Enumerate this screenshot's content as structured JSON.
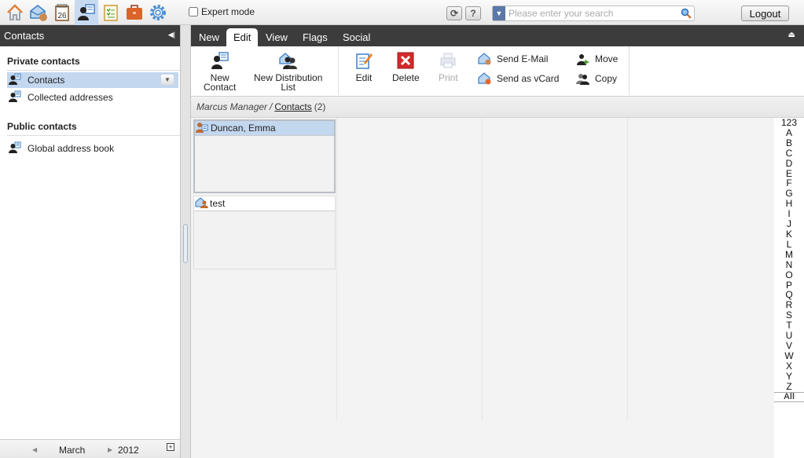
{
  "topbar": {
    "apps": [
      {
        "name": "portal",
        "icon": "home-icon"
      },
      {
        "name": "mail",
        "icon": "mail-icon"
      },
      {
        "name": "calendar",
        "icon": "calendar-icon",
        "label": "26"
      },
      {
        "name": "contacts",
        "icon": "contacts-icon",
        "active": true
      },
      {
        "name": "tasks",
        "icon": "tasks-icon"
      },
      {
        "name": "infostore",
        "icon": "briefcase-icon"
      },
      {
        "name": "settings",
        "icon": "gear-icon"
      }
    ],
    "expert_mode_label": "Expert mode",
    "expert_mode_checked": false,
    "refresh_label": "⟳",
    "help_label": "?",
    "search_placeholder": "Please enter your search",
    "search_value": "",
    "logout_label": "Logout"
  },
  "sidebar": {
    "title": "Contacts",
    "private_title": "Private contacts",
    "private_items": [
      {
        "label": "Contacts",
        "selected": true
      },
      {
        "label": "Collected addresses",
        "selected": false
      }
    ],
    "public_title": "Public contacts",
    "public_items": [
      {
        "label": "Global address book"
      }
    ],
    "footer": {
      "month": "March",
      "year": "2012"
    }
  },
  "tabs": [
    {
      "label": "New",
      "active": false
    },
    {
      "label": "Edit",
      "active": true
    },
    {
      "label": "View",
      "active": false
    },
    {
      "label": "Flags",
      "active": false
    },
    {
      "label": "Social",
      "active": false
    }
  ],
  "toolbar": {
    "new_contact_line1": "New",
    "new_contact_line2": "Contact",
    "new_distlist_line1": "New Distribution",
    "new_distlist_line2": "List",
    "edit": "Edit",
    "delete": "Delete",
    "print": "Print",
    "send_email": "Send E-Mail",
    "send_vcard": "Send as vCard",
    "move": "Move",
    "copy": "Copy"
  },
  "breadcrumb": {
    "user": "Marcus Manager",
    "separator": "/",
    "folder": "Contacts",
    "count": "(2)"
  },
  "contacts": [
    {
      "name": "Duncan, Emma",
      "type": "contact",
      "selected": true
    },
    {
      "name": "test",
      "type": "distribution-list",
      "selected": false
    }
  ],
  "alphabet": [
    "123",
    "A",
    "B",
    "C",
    "D",
    "E",
    "F",
    "G",
    "H",
    "I",
    "J",
    "K",
    "L",
    "M",
    "N",
    "O",
    "P",
    "Q",
    "R",
    "S",
    "T",
    "U",
    "V",
    "W",
    "X",
    "Y",
    "Z"
  ],
  "alphabet_all": "All",
  "colors": {
    "accent_selected": "#c3d7ef",
    "header_dark": "#3c3c3c",
    "search_drop": "#5b78a8"
  }
}
